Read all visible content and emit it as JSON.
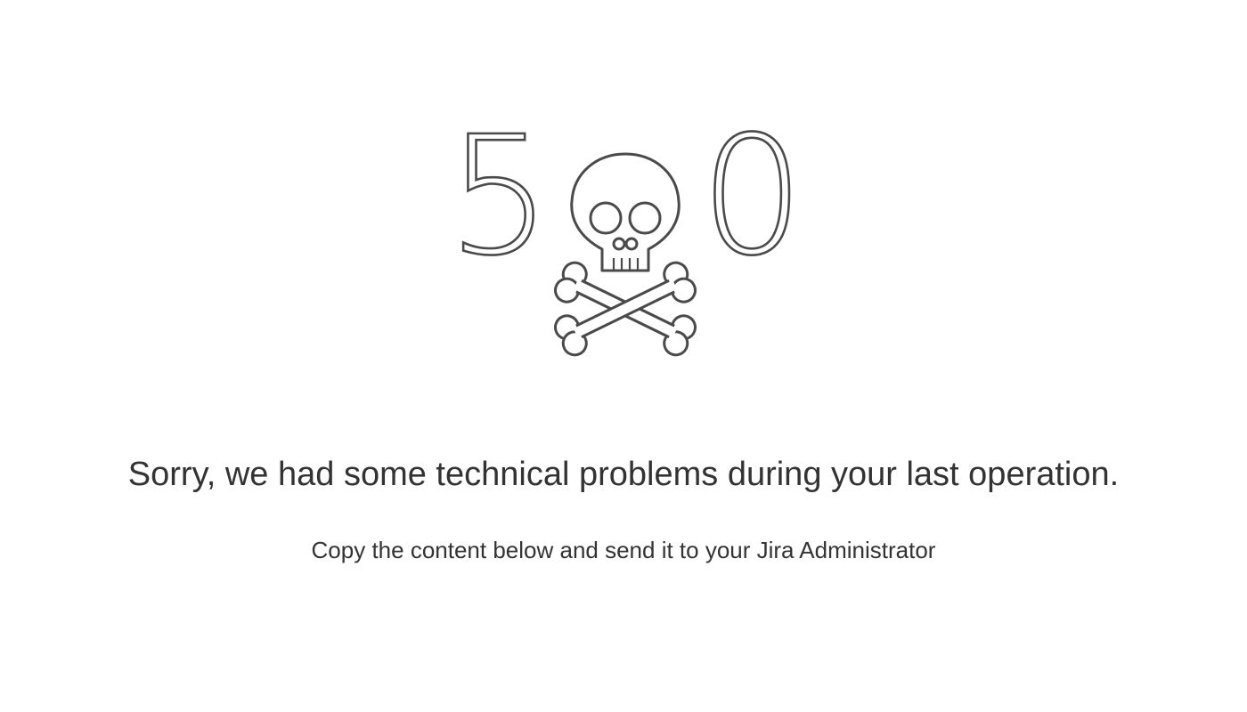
{
  "error": {
    "code_digits": [
      "5",
      "0"
    ],
    "icon": "skull-and-crossbones-icon",
    "stroke_color": "#4a4a4a"
  },
  "message": {
    "title": "Sorry, we had some technical problems during your last operation.",
    "instruction": "Copy the content below and send it to your Jira Administrator"
  },
  "colors": {
    "background": "#ffffff",
    "text": "#333333"
  }
}
